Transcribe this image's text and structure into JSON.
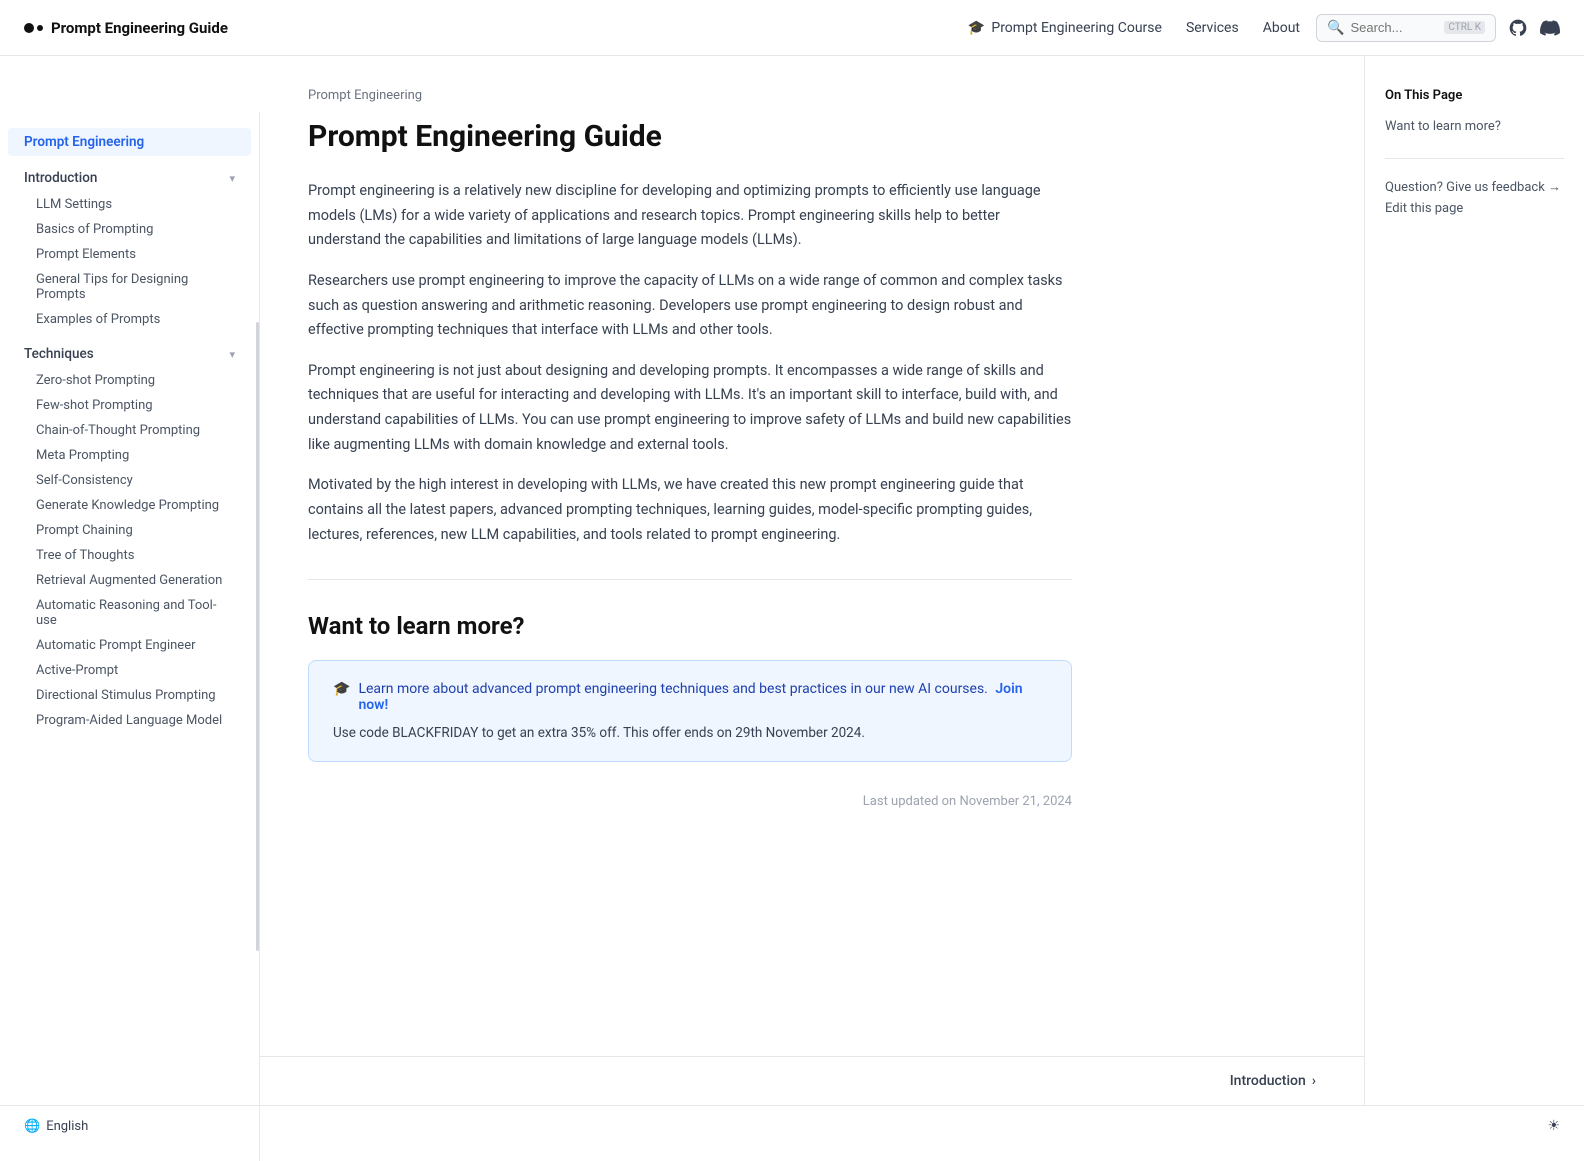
{
  "topnav": {
    "logo_text": "Prompt Engineering Guide",
    "course_link": "Prompt Engineering Course",
    "services_link": "Services",
    "about_link": "About",
    "search_placeholder": "Search...",
    "search_shortcut": "CTRL K"
  },
  "sidebar": {
    "active_item": "Prompt Engineering",
    "sections": [
      {
        "label": "Prompt Engineering",
        "type": "active",
        "level": 0
      },
      {
        "label": "Introduction",
        "type": "section-header",
        "level": 0,
        "has_chevron": true
      },
      {
        "label": "LLM Settings",
        "type": "subitem",
        "level": 1
      },
      {
        "label": "Basics of Prompting",
        "type": "subitem",
        "level": 1
      },
      {
        "label": "Prompt Elements",
        "type": "subitem",
        "level": 1
      },
      {
        "label": "General Tips for Designing Prompts",
        "type": "subitem",
        "level": 1
      },
      {
        "label": "Examples of Prompts",
        "type": "subitem",
        "level": 1
      },
      {
        "label": "Techniques",
        "type": "section-header",
        "level": 0,
        "has_chevron": true
      },
      {
        "label": "Zero-shot Prompting",
        "type": "subitem",
        "level": 1
      },
      {
        "label": "Few-shot Prompting",
        "type": "subitem",
        "level": 1
      },
      {
        "label": "Chain-of-Thought Prompting",
        "type": "subitem",
        "level": 1
      },
      {
        "label": "Meta Prompting",
        "type": "subitem",
        "level": 1
      },
      {
        "label": "Self-Consistency",
        "type": "subitem",
        "level": 1
      },
      {
        "label": "Generate Knowledge Prompting",
        "type": "subitem",
        "level": 1
      },
      {
        "label": "Prompt Chaining",
        "type": "subitem",
        "level": 1
      },
      {
        "label": "Tree of Thoughts",
        "type": "subitem",
        "level": 1
      },
      {
        "label": "Retrieval Augmented Generation",
        "type": "subitem",
        "level": 1
      },
      {
        "label": "Automatic Reasoning and Tool-use",
        "type": "subitem",
        "level": 1
      },
      {
        "label": "Automatic Prompt Engineer",
        "type": "subitem",
        "level": 1
      },
      {
        "label": "Active-Prompt",
        "type": "subitem",
        "level": 1
      },
      {
        "label": "Directional Stimulus Prompting",
        "type": "subitem",
        "level": 1
      },
      {
        "label": "Program-Aided Language Model",
        "type": "subitem",
        "level": 1
      }
    ]
  },
  "main": {
    "breadcrumb": "Prompt Engineering",
    "title": "Prompt Engineering Guide",
    "paragraphs": [
      "Prompt engineering is a relatively new discipline for developing and optimizing prompts to efficiently use language models (LMs) for a wide variety of applications and research topics. Prompt engineering skills help to better understand the capabilities and limitations of large language models (LLMs).",
      "Researchers use prompt engineering to improve the capacity of LLMs on a wide range of common and complex tasks such as question answering and arithmetic reasoning. Developers use prompt engineering to design robust and effective prompting techniques that interface with LLMs and other tools.",
      "Prompt engineering is not just about designing and developing prompts. It encompasses a wide range of skills and techniques that are useful for interacting and developing with LLMs. It's an important skill to interface, build with, and understand capabilities of LLMs. You can use prompt engineering to improve safety of LLMs and build new capabilities like augmenting LLMs with domain knowledge and external tools.",
      "Motivated by the high interest in developing with LLMs, we have created this new prompt engineering guide that contains all the latest papers, advanced prompting techniques, learning guides, model-specific prompting guides, lectures, references, new LLM capabilities, and tools related to prompt engineering."
    ],
    "want_to_learn": {
      "section_title": "Want to learn more?",
      "promo_text": "Learn more about advanced prompt engineering techniques and best practices in our new AI courses.",
      "promo_link_text": "Join now!",
      "promo_code": "Use code BLACKFRIDAY to get an extra 35% off. This offer ends on 29th November 2024."
    },
    "last_updated": "Last updated on November 21, 2024"
  },
  "right_panel": {
    "title": "On This Page",
    "items": [
      "Want to learn more?"
    ],
    "feedback": "Question? Give us feedback →",
    "edit": "Edit this page"
  },
  "bottom_nav": {
    "next_label": "Introduction",
    "next_arrow": "›"
  },
  "footer": {
    "language": "English",
    "theme_icon": "☀"
  }
}
